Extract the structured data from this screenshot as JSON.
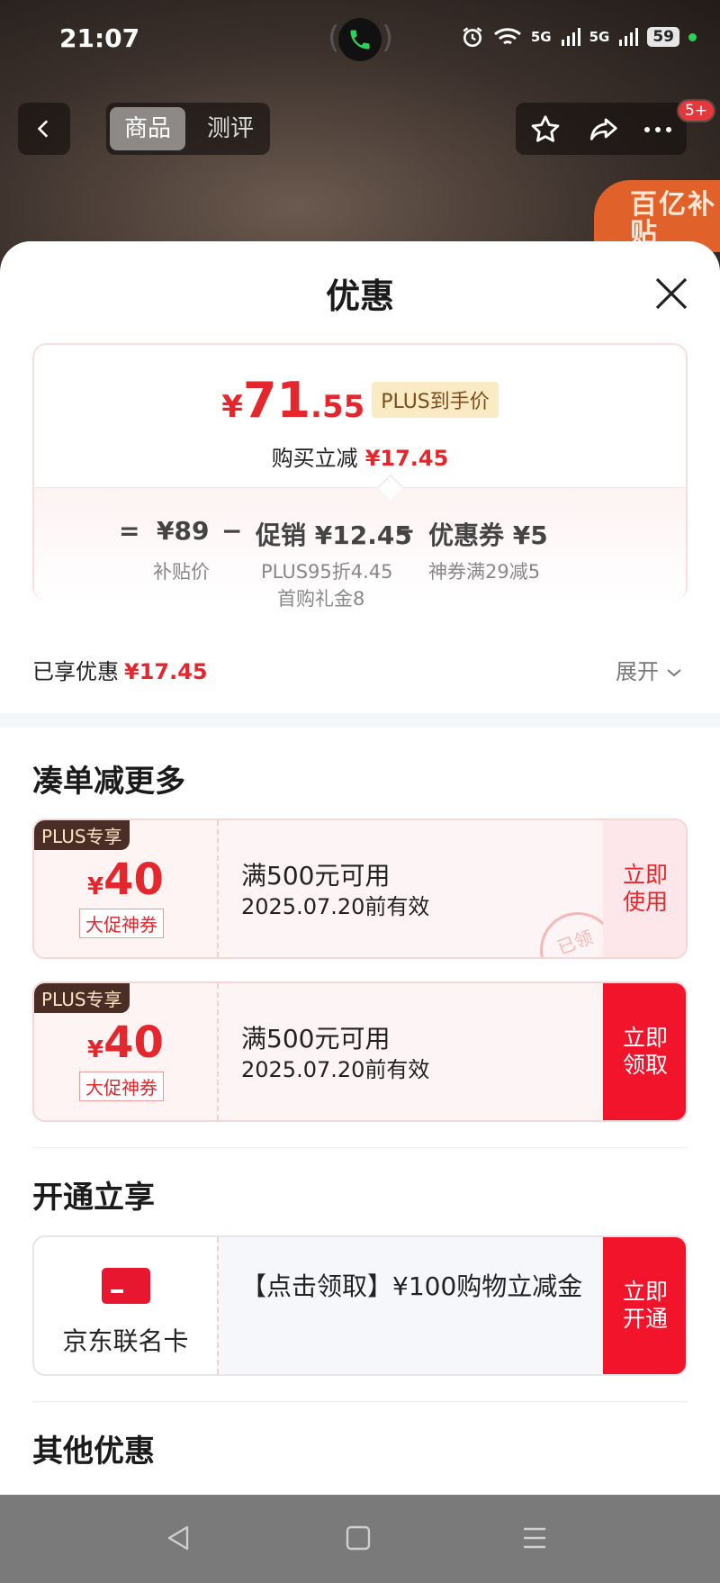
{
  "status_bar": {
    "time": "21:07",
    "network_1": "5G",
    "network_2": "5G",
    "battery": "59"
  },
  "nav": {
    "tabs": [
      {
        "label": "商品",
        "active": true
      },
      {
        "label": "测评",
        "active": false
      }
    ],
    "badge": "5+",
    "subsidy_banner": "百亿补贴"
  },
  "sheet": {
    "title": "优惠",
    "price_card": {
      "price_yen": "¥",
      "price_int": "71",
      "price_dec": ".55",
      "price_tag": "PLUS到手价",
      "instant_label": "购买立减",
      "instant_value": "¥17.45",
      "formula": {
        "eq": "=",
        "base": "¥89",
        "base_label": "补贴价",
        "minus_1": "−",
        "promo": "促销 ¥12.45",
        "promo_sub_1": "PLUS95折4.45",
        "promo_sub_2": "首购礼金8",
        "minus_2": "−",
        "coupon": "优惠券 ¥5",
        "coupon_label": "神券满29减5"
      }
    },
    "enjoyed_label": "已享优惠",
    "enjoyed_value": "¥17.45",
    "expand_label": "展开"
  },
  "more_section": {
    "title": "凑单减更多",
    "coupons": [
      {
        "badge": "PLUS专享",
        "yen": "¥",
        "amount": "40",
        "type": "大促神券",
        "condition": "满500元可用",
        "validity": "2025.07.20前有效",
        "button": "立即\n使用",
        "stamp": "已领"
      },
      {
        "badge": "PLUS专享",
        "yen": "¥",
        "amount": "40",
        "type": "大促神券",
        "condition": "满500元可用",
        "validity": "2025.07.20前有效",
        "button": "立即\n领取"
      }
    ]
  },
  "open_section": {
    "title": "开通立享",
    "card_name": "京东联名卡",
    "offer": "【点击领取】¥100购物立减金",
    "button": "立即\n开通"
  },
  "other_section": {
    "title": "其他优惠"
  },
  "colors": {
    "accent_red": "#e4262d",
    "button_red": "#f1142b",
    "plus_badge_bg": "#4a2e25"
  }
}
